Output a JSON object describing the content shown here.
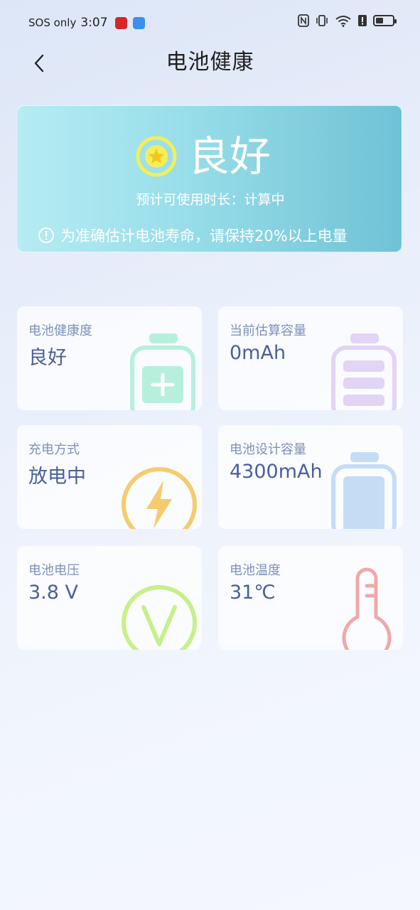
{
  "status_bar": {
    "carrier": "SOS only",
    "time": "3:07"
  },
  "header": {
    "title": "电池健康"
  },
  "hero": {
    "status": "良好",
    "subtitle": "预计可使用时长：计算中",
    "tip": "为准确估计电池寿命，请保持20%以上电量"
  },
  "cards": [
    {
      "label": "电池健康度",
      "value": "良好",
      "icon": "battery-plus-icon",
      "color": "#b6f0dc"
    },
    {
      "label": "当前估算容量",
      "value": "0mAh",
      "icon": "battery-levels-icon",
      "color": "#e2d4f5"
    },
    {
      "label": "充电方式",
      "value": "放电中",
      "icon": "lightning-icon",
      "color": "#f6cb6e"
    },
    {
      "label": "电池设计容量",
      "value": "4300mAh",
      "icon": "battery-full-icon",
      "color": "#c5dcf5"
    },
    {
      "label": "电池电压",
      "value": "3.8 V",
      "icon": "voltage-icon",
      "color": "#c6f08a"
    },
    {
      "label": "电池温度",
      "value": "31℃",
      "icon": "thermometer-icon",
      "color": "#f1a8a8"
    }
  ]
}
